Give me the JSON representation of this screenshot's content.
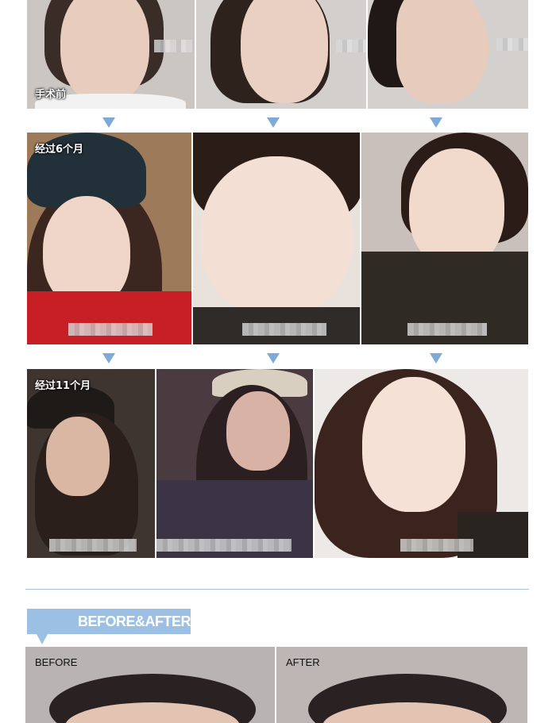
{
  "stages": {
    "before_surgery": "手术前",
    "after_6_months": "经过6个月",
    "after_11_months": "经过11个月"
  },
  "section": {
    "banner_title": "BEFORE&AFTER",
    "before_label": "BEFORE",
    "after_label": "AFTER"
  },
  "colors": {
    "accent": "#7fa9d6",
    "banner": "#9cc0e4",
    "divider": "#a9c4e0"
  }
}
